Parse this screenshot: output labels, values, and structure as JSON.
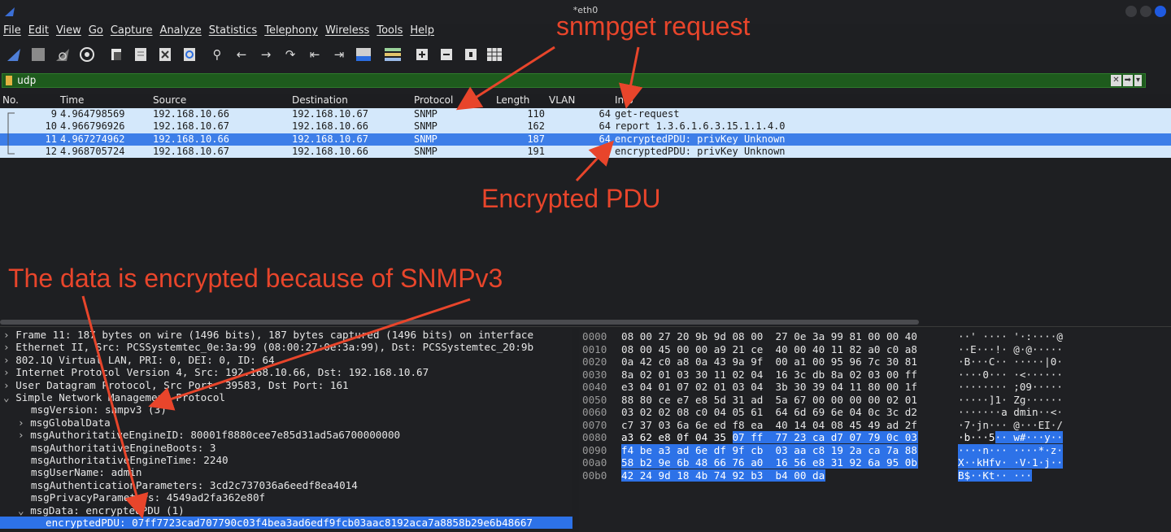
{
  "window": {
    "title": "*eth0"
  },
  "menu": [
    "File",
    "Edit",
    "View",
    "Go",
    "Capture",
    "Analyze",
    "Statistics",
    "Telephony",
    "Wireless",
    "Tools",
    "Help"
  ],
  "toolbar_icons": [
    "shark-fin-start-icon",
    "stop-square-icon",
    "restart-fin-icon",
    "gear-options-icon",
    "open-file-icon",
    "save-file-icon",
    "close-file-icon",
    "reload-icon",
    "search-icon",
    "back-arrow-icon",
    "forward-arrow-icon",
    "go-to-packet-icon",
    "first-packet-icon",
    "last-packet-icon",
    "autoscroll-icon",
    "colorize-icon",
    "zoom-in-icon",
    "zoom-out-icon",
    "normal-size-icon",
    "resize-columns-icon"
  ],
  "filter": {
    "value": "udp",
    "clear": "✕",
    "apply": "➡",
    "dropdown": "▾",
    "add": "+"
  },
  "packet_list": {
    "columns": [
      "No.",
      "Time",
      "Source",
      "Destination",
      "Protocol",
      "Length",
      "VLAN",
      "Info"
    ],
    "rows": [
      {
        "no": "9",
        "time": "4.964798569",
        "src": "192.168.10.66",
        "dst": "192.168.10.67",
        "proto": "SNMP",
        "len": "110",
        "vlan": "64",
        "info": "get-request",
        "selected": false
      },
      {
        "no": "10",
        "time": "4.966796926",
        "src": "192.168.10.67",
        "dst": "192.168.10.66",
        "proto": "SNMP",
        "len": "162",
        "vlan": "64",
        "info": "report 1.3.6.1.6.3.15.1.1.4.0",
        "selected": false
      },
      {
        "no": "11",
        "time": "4.967274962",
        "src": "192.168.10.66",
        "dst": "192.168.10.67",
        "proto": "SNMP",
        "len": "187",
        "vlan": "64",
        "info": "encryptedPDU: privKey Unknown",
        "selected": true
      },
      {
        "no": "12",
        "time": "4.968705724",
        "src": "192.168.10.67",
        "dst": "192.168.10.66",
        "proto": "SNMP",
        "len": "191",
        "vlan": "64",
        "info": "encryptedPDU: privKey Unknown",
        "selected": false
      }
    ]
  },
  "details": [
    {
      "arrow": "›",
      "text": "Frame 11: 187 bytes on wire (1496 bits), 187 bytes captured (1496 bits) on interface"
    },
    {
      "arrow": "›",
      "text": "Ethernet II, Src: PCSSystemtec_0e:3a:99 (08:00:27:0e:3a:99), Dst: PCSSystemtec_20:9b"
    },
    {
      "arrow": "›",
      "text": "802.1Q Virtual LAN, PRI: 0, DEI: 0, ID: 64"
    },
    {
      "arrow": "›",
      "text": "Internet Protocol Version 4, Src: 192.168.10.66, Dst: 192.168.10.67"
    },
    {
      "arrow": "›",
      "text": "User Datagram Protocol, Src Port: 39583, Dst Port: 161"
    },
    {
      "arrow": "⌄",
      "text": "Simple Network Management Protocol"
    },
    {
      "arrow": "",
      "text": "msgVersion: snmpv3 (3)"
    },
    {
      "arrow": "›",
      "text": "msgGlobalData"
    },
    {
      "arrow": "›",
      "text": "msgAuthoritativeEngineID: 80001f8880cee7e85d31ad5a6700000000"
    },
    {
      "arrow": "",
      "text": "msgAuthoritativeEngineBoots: 3"
    },
    {
      "arrow": "",
      "text": "msgAuthoritativeEngineTime: 2240"
    },
    {
      "arrow": "",
      "text": "msgUserName: admin"
    },
    {
      "arrow": "",
      "text": "msgAuthenticationParameters: 3cd2c737036a6eedf8ea4014"
    },
    {
      "arrow": "",
      "text": "msgPrivacyParameters: 4549ad2fa362e80f"
    },
    {
      "arrow": "⌄",
      "text": "msgData: encryptedPDU (1)"
    },
    {
      "arrow": "",
      "text": "encryptedPDU: 07ff7723cad707790c03f4bea3ad6edf9fcb03aac8192aca7a8858b29e6b48667"
    }
  ],
  "hex": {
    "offsets": [
      "0000",
      "0010",
      "0020",
      "0030",
      "0040",
      "0050",
      "0060",
      "0070",
      "0080",
      "0090",
      "00a0",
      "00b0"
    ],
    "bytes": [
      "08 00 27 20 9b 9d 08 00  27 0e 3a 99 81 00 00 40",
      "08 00 45 00 00 a9 21 ce  40 00 40 11 82 a0 c0 a8",
      "0a 42 c0 a8 0a 43 9a 9f  00 a1 00 95 96 7c 30 81",
      "8a 02 01 03 30 11 02 04  16 3c db 8a 02 03 00 ff",
      "e3 04 01 07 02 01 03 04  3b 30 39 04 11 80 00 1f",
      "88 80 ce e7 e8 5d 31 ad  5a 67 00 00 00 00 02 01",
      "03 02 02 08 c0 04 05 61  64 6d 69 6e 04 0c 3c d2",
      "c7 37 03 6a 6e ed f8 ea  40 14 04 08 45 49 ad 2f",
      "a3 62 e8 0f 04 35 07 ff  77 23 ca d7 07 79 0c 03",
      "f4 be a3 ad 6e df 9f cb  03 aa c8 19 2a ca 7a 88",
      "58 b2 9e 6b 48 66 76 a0  16 56 e8 31 92 6a 95 0b",
      "42 24 9d 18 4b 74 92 b3  b4 00 da"
    ],
    "ascii": [
      "··' ···· '·:····@",
      "··E···!· @·@·····",
      "·B···C·· ·····|0·",
      "····0··· ·<······",
      "········ ;09·····",
      "·····]1· Zg······",
      "·······a dmin··<·",
      "·7·jn··· @···EI·/",
      "·b···5·· w#···y··",
      "····n··· ····*·z·",
      "X··kHfv· ·V·1·j··",
      "B$··Kt·· ···"
    ]
  },
  "annotations": {
    "snmpget": "snmpget request",
    "encrypted_pdu": "Encrypted PDU",
    "snmpv3": "The data is encrypted because of SNMPv3"
  },
  "colors": {
    "annotation": "#e8452b",
    "selection": "#3d7ee8",
    "row": "#d4e8fb",
    "filter_ok": "#1e5b1d"
  }
}
